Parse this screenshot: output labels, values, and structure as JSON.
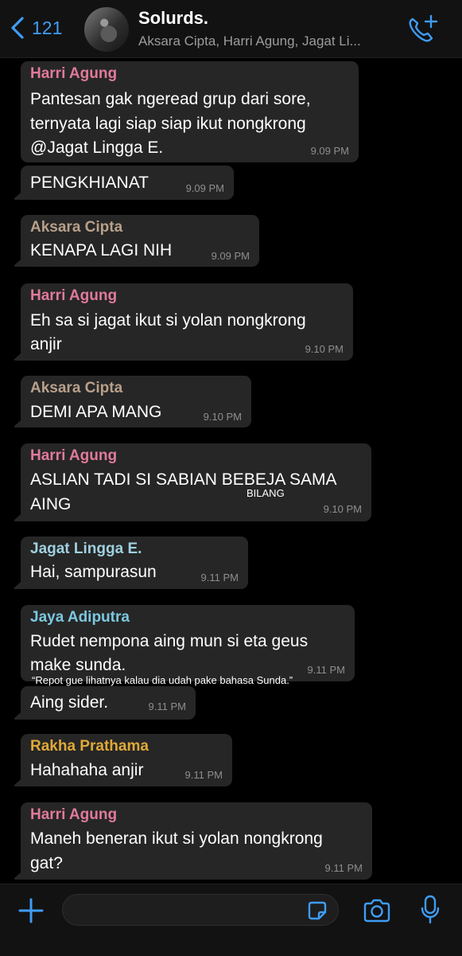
{
  "header": {
    "back_count": "121",
    "title": "Solurds.",
    "subtitle": "Aksara Cipta, Harri Agung, Jagat Li...",
    "accent_color": "#3f9cf5",
    "icons": [
      "chevron-left-icon",
      "group-avatar",
      "call-add-icon"
    ]
  },
  "messages": [
    {
      "sender": "Harri Agung",
      "sender_color": "#e07a9a",
      "lines": [
        "Pantesan gak ngeread grup dari sore,",
        "ternyata lagi siap siap ikut nongkrong",
        "@Jagat Lingga E."
      ],
      "time": "9.09 PM"
    },
    {
      "sender": "",
      "lines": [
        "PENGKHIANAT"
      ],
      "time": "9.09 PM"
    },
    {
      "sender": "Aksara Cipta",
      "sender_color": "#b8a08a",
      "lines": [
        "KENAPA LAGI NIH"
      ],
      "time": "9.09 PM"
    },
    {
      "sender": "Harri Agung",
      "sender_color": "#e07a9a",
      "lines": [
        "Eh sa si jagat ikut si yolan nongkrong",
        "anjir"
      ],
      "time": "9.10 PM"
    },
    {
      "sender": "Aksara Cipta",
      "sender_color": "#b8a08a",
      "lines": [
        "DEMI APA MANG"
      ],
      "time": "9.10 PM"
    },
    {
      "sender": "Harri Agung",
      "sender_color": "#e07a9a",
      "lines": [
        "ASLIAN TADI SI SABIAN BEBEJA SAMA",
        "AING"
      ],
      "time": "9.10 PM",
      "annotation": "BILANG"
    },
    {
      "sender": "Jagat Lingga E.",
      "sender_color": "#9fd0e0",
      "lines": [
        "Hai, sampurasun"
      ],
      "time": "9.11 PM"
    },
    {
      "sender": "Jaya Adiputra",
      "sender_color": "#7cc8e0",
      "lines": [
        "Rudet nempona aing mun si eta geus",
        "make sunda."
      ],
      "time": "9.11 PM",
      "annotation": "“Repot gue lihatnya kalau dia udah pake bahasa Sunda.”"
    },
    {
      "sender": "",
      "lines": [
        "Aing sider."
      ],
      "time": "9.11 PM"
    },
    {
      "sender": "Rakha Prathama",
      "sender_color": "#e0a838",
      "lines": [
        "Hahahaha anjir"
      ],
      "time": "9.11 PM"
    },
    {
      "sender": "Harri Agung",
      "sender_color": "#e07a9a",
      "lines": [
        "Maneh beneran ikut si yolan nongkrong",
        "gat?"
      ],
      "time": "9.11 PM"
    }
  ],
  "composer": {
    "input_value": "",
    "icons": [
      "plus-icon",
      "sticker-icon",
      "camera-icon",
      "microphone-icon"
    ]
  }
}
